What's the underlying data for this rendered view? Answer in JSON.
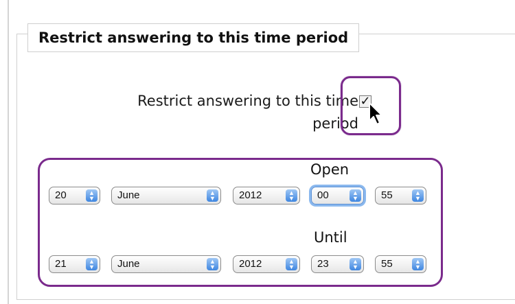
{
  "section": {
    "legend": "Restrict answering to this time period"
  },
  "restrict_checkbox": {
    "label_line1": "Restrict answering to this time",
    "label_line2": "period",
    "checked_glyph": "✓"
  },
  "open": {
    "label": "Open",
    "day": "20",
    "month": "June",
    "year": "2012",
    "hour": "00",
    "minute": "55"
  },
  "until": {
    "label": "Until",
    "day": "21",
    "month": "June",
    "year": "2012",
    "hour": "23",
    "minute": "55"
  },
  "icons": {
    "select_arrows": "⬍"
  },
  "colors": {
    "highlight_border": "#7a2a8c",
    "select_arrow_blue": "#3f86e0"
  }
}
